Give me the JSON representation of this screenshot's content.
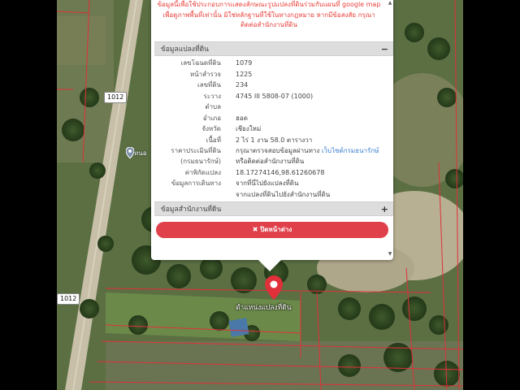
{
  "colors": {
    "accent": "#e0404a",
    "link": "#3b7fd0",
    "notice": "#e8403a",
    "parcel_line": "#e0303a"
  },
  "notice": {
    "line1": "ข้อมูลนี้เพื่อใช้ประกอบการแสดงลักษณะรูปแปลงที่ดินร่วมกับแผนที่ google map",
    "line2": "เพื่อดูภาพพื้นที่เท่านั้น มิใช่หลักฐานที่ใช้ในทางกฎหมาย หากมีข้อสงสัย กรุณา",
    "line3": "ติดต่อสำนักงานที่ดิน"
  },
  "land_panel": {
    "title": "ข้อมูลแปลงที่ดิน",
    "toggle": "−"
  },
  "land_info": [
    {
      "label": "เลขโฉนดที่ดิน",
      "value": "1079"
    },
    {
      "label": "หน้าสำรวจ",
      "value": "1225"
    },
    {
      "label": "เลขที่ดิน",
      "value": "234"
    },
    {
      "label": "ระวาง",
      "value": "4745 III 5808-07 (1000)"
    },
    {
      "label": "ตำบล",
      "value": ""
    },
    {
      "label": "อำเภอ",
      "value": "ฮอด"
    },
    {
      "label": "จังหวัด",
      "value": "เชียงใหม่"
    },
    {
      "label": "เนื้อที่",
      "value": "2 ไร่ 1 งาน 58.0 ตารางวา"
    }
  ],
  "price": {
    "label": "ราคาประเมินที่ดิน",
    "label2": "(กรมธนารักษ์)",
    "text": "กรุณาตรวจสอบข้อมูลผ่านทาง ",
    "link": "เว็บไซต์กรมธนารักษ์",
    "line2": "หรือติดต่อสำนักงานที่ดิน"
  },
  "coords": {
    "label": "ค่าพิกัดแปลง",
    "value": "18.17274146,98.61260678"
  },
  "travel": {
    "label": "ข้อมูลการเดินทาง",
    "link1": "จากที่นี่ไปยังแปลงที่ดิน",
    "link2": "จากแปลงที่ดินไปยังสำนักงานที่ดิน"
  },
  "office_panel": {
    "title": "ข้อมูลสำนักงานที่ดิน",
    "toggle": "+"
  },
  "close_button": {
    "icon": "✖",
    "label": "ปิดหน้าต่าง"
  },
  "map": {
    "road_label_1": "1012",
    "road_label_2": "1012",
    "place_label": "หนอ",
    "marker_label": "ตำแหน่งแปลงที่ดิน"
  },
  "icons": {
    "marker": "map-pin-icon",
    "place": "place-pin-icon",
    "close": "close-x-icon"
  }
}
